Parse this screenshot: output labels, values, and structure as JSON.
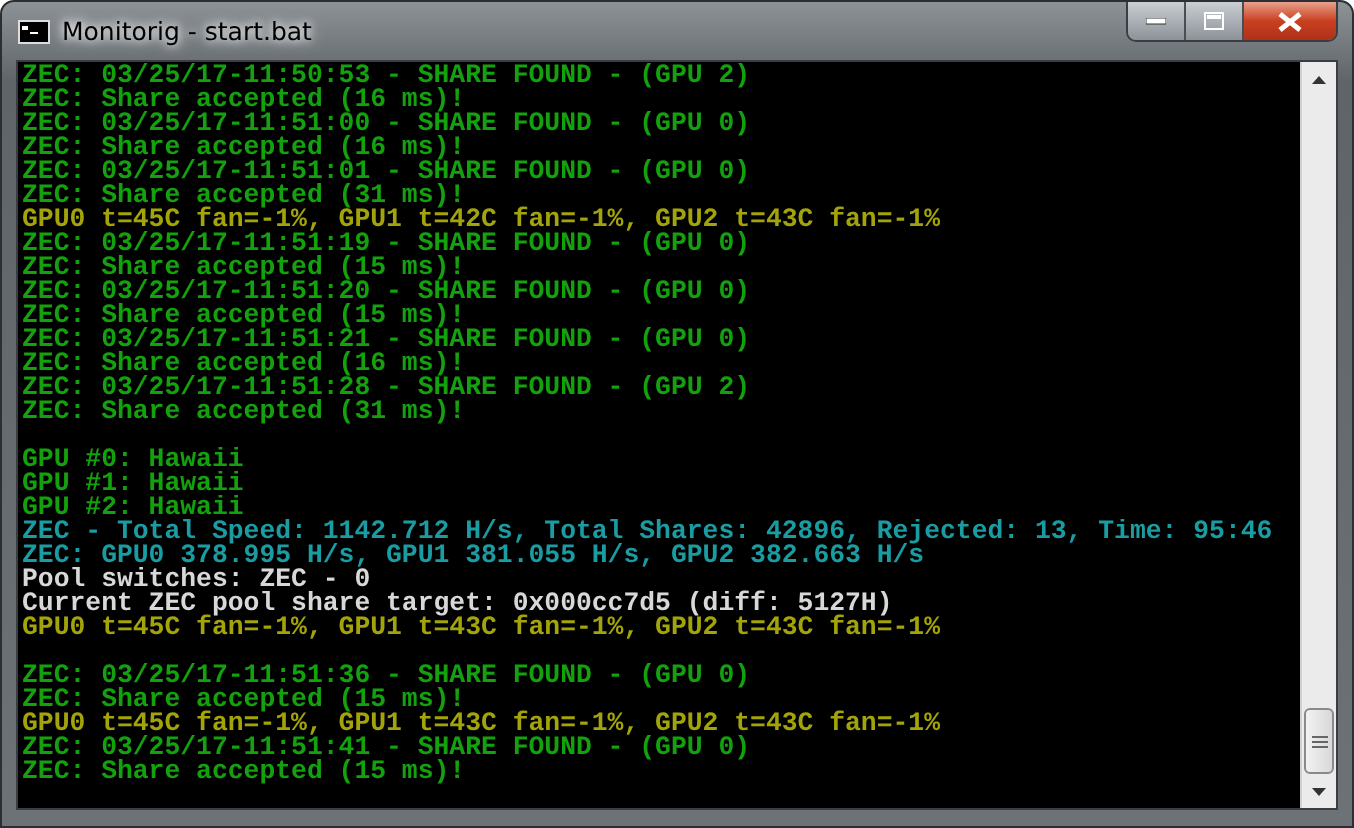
{
  "window": {
    "title": "Monitorig - start.bat"
  },
  "console": {
    "lines": [
      {
        "kind": "green",
        "text": "ZEC: 03/25/17-11:50:53 - SHARE FOUND - (GPU 2)"
      },
      {
        "kind": "green",
        "text": "ZEC: Share accepted (16 ms)!"
      },
      {
        "kind": "green",
        "text": "ZEC: 03/25/17-11:51:00 - SHARE FOUND - (GPU 0)"
      },
      {
        "kind": "green",
        "text": "ZEC: Share accepted (16 ms)!"
      },
      {
        "kind": "green",
        "text": "ZEC: 03/25/17-11:51:01 - SHARE FOUND - (GPU 0)"
      },
      {
        "kind": "green",
        "text": "ZEC: Share accepted (31 ms)!"
      },
      {
        "kind": "yellow",
        "text": "GPU0 t=45C fan=-1%, GPU1 t=42C fan=-1%, GPU2 t=43C fan=-1%"
      },
      {
        "kind": "green",
        "text": "ZEC: 03/25/17-11:51:19 - SHARE FOUND - (GPU 0)"
      },
      {
        "kind": "green",
        "text": "ZEC: Share accepted (15 ms)!"
      },
      {
        "kind": "green",
        "text": "ZEC: 03/25/17-11:51:20 - SHARE FOUND - (GPU 0)"
      },
      {
        "kind": "green",
        "text": "ZEC: Share accepted (15 ms)!"
      },
      {
        "kind": "green",
        "text": "ZEC: 03/25/17-11:51:21 - SHARE FOUND - (GPU 0)"
      },
      {
        "kind": "green",
        "text": "ZEC: Share accepted (16 ms)!"
      },
      {
        "kind": "green",
        "text": "ZEC: 03/25/17-11:51:28 - SHARE FOUND - (GPU 2)"
      },
      {
        "kind": "green",
        "text": "ZEC: Share accepted (31 ms)!"
      },
      {
        "kind": "blank"
      },
      {
        "kind": "green",
        "text": "GPU #0: Hawaii"
      },
      {
        "kind": "green",
        "text": "GPU #1: Hawaii"
      },
      {
        "kind": "green",
        "text": "GPU #2: Hawaii"
      },
      {
        "kind": "cyan",
        "text": "ZEC - Total Speed: 1142.712 H/s, Total Shares: 42896, Rejected: 13, Time: 95:46"
      },
      {
        "kind": "cyan",
        "text": "ZEC: GPU0 378.995 H/s, GPU1 381.055 H/s, GPU2 382.663 H/s"
      },
      {
        "kind": "white",
        "text": "Pool switches: ZEC - 0"
      },
      {
        "kind": "white",
        "text": "Current ZEC pool share target: 0x000cc7d5 (diff: 5127H)"
      },
      {
        "kind": "yellow",
        "text": "GPU0 t=45C fan=-1%, GPU1 t=43C fan=-1%, GPU2 t=43C fan=-1%"
      },
      {
        "kind": "blank"
      },
      {
        "kind": "green",
        "text": "ZEC: 03/25/17-11:51:36 - SHARE FOUND - (GPU 0)"
      },
      {
        "kind": "green",
        "text": "ZEC: Share accepted (15 ms)!"
      },
      {
        "kind": "yellow",
        "text": "GPU0 t=45C fan=-1%, GPU1 t=43C fan=-1%, GPU2 t=43C fan=-1%"
      },
      {
        "kind": "green",
        "text": "ZEC: 03/25/17-11:51:41 - SHARE FOUND - (GPU 0)"
      },
      {
        "kind": "green",
        "text": "ZEC: Share accepted (15 ms)!"
      }
    ]
  }
}
